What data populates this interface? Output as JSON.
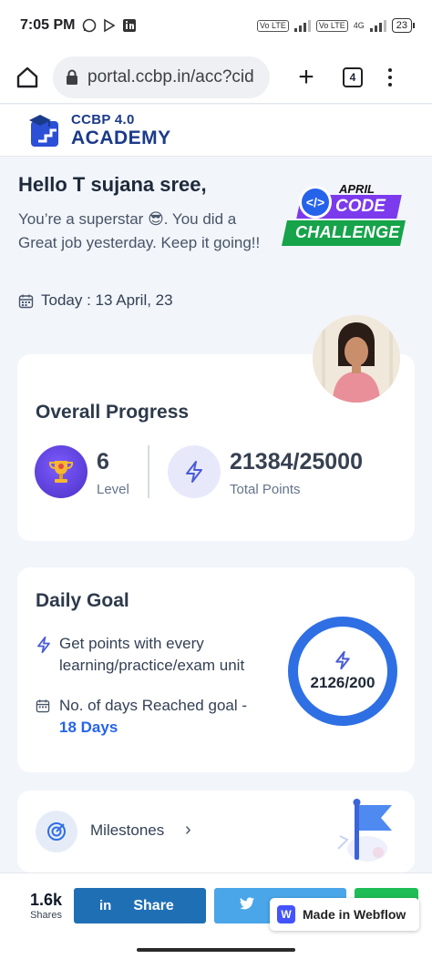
{
  "status_bar": {
    "time": "7:05 PM",
    "volte_label": "Vo LTE",
    "net_label": "4G",
    "battery": "23"
  },
  "browser": {
    "url": "portal.ccbp.in/acc?cid",
    "tab_count": "4"
  },
  "site": {
    "logo_line1": "CCBP 4.0",
    "logo_line2": "ACADEMY"
  },
  "greeting": {
    "title": "Hello T sujana sree,",
    "message": "You’re a superstar 😎. You did a Great job yesterday. Keep it going!!",
    "date": "Today : 13 April, 23"
  },
  "promo": {
    "line1": "APRIL",
    "line2": "CODE",
    "line3": "CHALLENGE",
    "icon_text": "</>"
  },
  "overall_progress": {
    "title": "Overall Progress",
    "level_value": "6",
    "level_label": "Level",
    "points_value": "21384/25000",
    "points_label": "Total Points",
    "points_earned": 21384,
    "points_total": 25000
  },
  "daily_goal": {
    "title": "Daily Goal",
    "row1_text": "Get points with every learning/practice/exam unit",
    "row2_text": "No. of days Reached goal - ",
    "row2_days": "18 Days",
    "ring_value": "2126/200"
  },
  "milestones": {
    "label": "Milestones"
  },
  "share_bar": {
    "count": "1.6k",
    "count_label": "Shares",
    "linkedin_icon": "in",
    "linkedin_label": "Share",
    "webflow_badge": "Made in Webflow",
    "webflow_logo": "W"
  },
  "colors": {
    "accent_blue": "#2f6fe4",
    "brand_navy": "#1b3a8a",
    "linkedin": "#1f6fb5",
    "twitter": "#4aa6e8",
    "whatsapp": "#1fbd56"
  }
}
